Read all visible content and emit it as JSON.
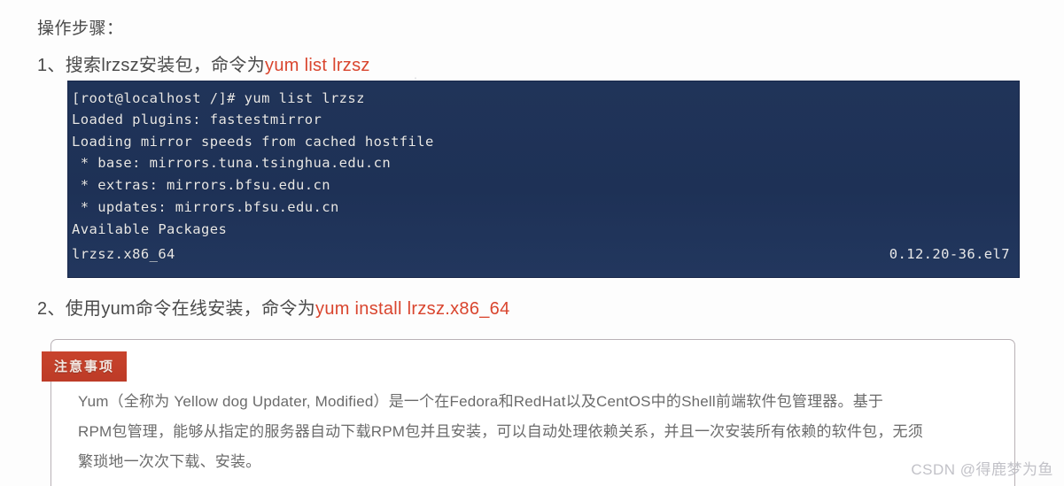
{
  "document": {
    "heading": "操作步骤：",
    "steps": [
      {
        "prefix": "1、搜索lrzsz安装包，命令为",
        "command": "yum list lrzsz"
      },
      {
        "prefix": "2、使用yum命令在线安装，命令为",
        "command": "yum install lrzsz.x86_64"
      }
    ]
  },
  "terminal": {
    "background_color": "#1f3359",
    "text_color": "#e8e8e8",
    "lines": [
      "[root@localhost /]# yum list lrzsz",
      "Loaded plugins: fastestmirror",
      "Loading mirror speeds from cached hostfile",
      " * base: mirrors.tuna.tsinghua.edu.cn",
      " * extras: mirrors.bfsu.edu.cn",
      " * updates: mirrors.bfsu.edu.cn",
      "Available Packages",
      "lrzsz.x86_64"
    ],
    "package_version": "0.12.20-36.el7"
  },
  "notice": {
    "badge_label": "注意事项",
    "badge_color": "#c2402b",
    "border_color": "#b9b2b6",
    "lines": [
      "Yum（全称为 Yellow dog Updater, Modified）是一个在Fedora和RedHat以及CentOS中的Shell前端软件包管理器。基于",
      "RPM包管理，能够从指定的服务器自动下载RPM包并且安装，可以自动处理依赖关系，并且一次安装所有依赖的软件包，无须",
      "繁琐地一次次下载、安装。"
    ]
  },
  "watermark": {
    "text": "CSDN @得鹿梦为鱼"
  }
}
